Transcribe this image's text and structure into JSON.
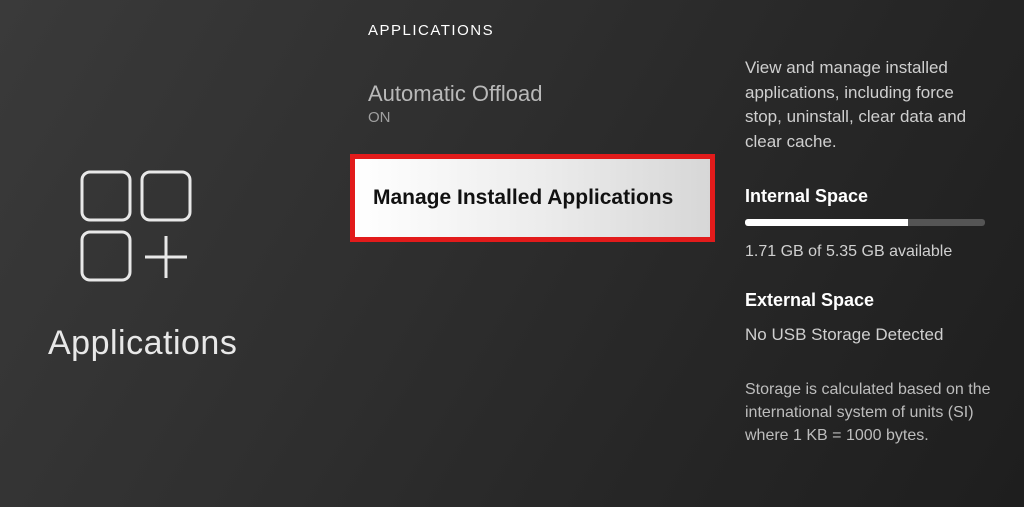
{
  "left": {
    "title": "Applications"
  },
  "middle": {
    "header": "APPLICATIONS",
    "items": [
      {
        "title": "Automatic Offload",
        "value": "ON"
      },
      {
        "title": "Manage Installed Applications"
      }
    ]
  },
  "right": {
    "description": "View and manage installed applications, including force stop, uninstall, clear data and clear cache.",
    "internal": {
      "label": "Internal Space",
      "used_fraction": 0.68,
      "text": "1.71 GB of 5.35 GB available"
    },
    "external": {
      "label": "External Space",
      "value": "No USB Storage Detected"
    },
    "footnote": "Storage is calculated based on the international system of units (SI) where 1 KB = 1000 bytes."
  },
  "highlight_color": "#e21b1b"
}
